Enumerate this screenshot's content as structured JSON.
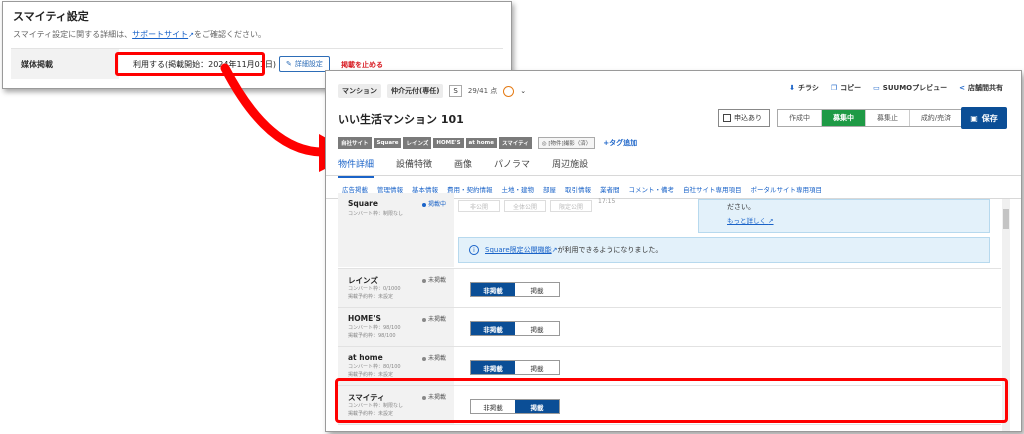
{
  "panel1": {
    "title": "スマイティ設定",
    "desc_prefix": "スマイティ設定に関する詳細は、",
    "desc_link": "サポートサイト",
    "desc_suffix": "をご確認ください。",
    "row_label": "媒体掲載",
    "status": "利用する(掲載開始：2024年11月01日)",
    "detail_button": "詳細設定",
    "stop_link": "掲載を止める"
  },
  "main": {
    "property_type": "マンション",
    "broker_type": "仲介元付(専任)",
    "grade": "S",
    "score": "29/41 点",
    "actions": [
      "チラシ",
      "コピー",
      "SUUMOプレビュー",
      "店舗間共有"
    ],
    "title": "いい生活マンション 101",
    "apply_label": "申込あり",
    "stages": [
      {
        "label": "作成中",
        "active": false
      },
      {
        "label": "募集中",
        "active": true
      },
      {
        "label": "募集止",
        "active": false
      },
      {
        "label": "成約/売済",
        "active": false
      }
    ],
    "save_label": "保存",
    "tags": [
      "自社サイト",
      "Square",
      "レインズ",
      "HOME'S",
      "at home",
      "スマイティ"
    ],
    "tag_extra": "◎ [物件]撮影（済）",
    "tag_add": "+タグ追加",
    "tabs": [
      "物件詳細",
      "設備特徴",
      "画像",
      "パノラマ",
      "周辺施設"
    ],
    "subnav": [
      "広告掲載",
      "管理情報",
      "基本情報",
      "費用・契約情報",
      "土地・建物",
      "部屋",
      "取引情報",
      "業者間",
      "コメント・備考",
      "自社サイト専用項目",
      "ポータルサイト専用項目"
    ],
    "square": {
      "name": "Square",
      "sub1": "コンバート枠：制限なし",
      "status": "掲載中",
      "ghost_buttons": [
        "非公開",
        "全体公開",
        "限定公開"
      ],
      "ghost_time": "17:15",
      "bubble_text": "ださい。",
      "bubble_more": "もっと詳しく",
      "info_link": "Square限定公開機能",
      "info_text": "が利用できるようになりました。"
    },
    "media_rows": [
      {
        "name": "レインズ",
        "sub1": "コンバート枠：0/1000",
        "sub2": "掲載予約枠：未設定",
        "status": "未掲載",
        "off": "非掲載",
        "on": "掲載",
        "selected": "off"
      },
      {
        "name": "HOME'S",
        "sub1": "コンバート枠：98/100",
        "sub2": "掲載予約枠：98/100",
        "status": "未掲載",
        "off": "非掲載",
        "on": "掲載",
        "selected": "off"
      },
      {
        "name": "at home",
        "sub1": "コンバート枠：80/100",
        "sub2": "掲載予約枠：未設定",
        "status": "未掲載",
        "off": "非掲載",
        "on": "掲載",
        "selected": "off"
      },
      {
        "name": "スマイティ",
        "sub1": "コンバート枠：制限なし",
        "sub2": "掲載予約枠：未設定",
        "status": "未掲載",
        "off": "非掲載",
        "on": "掲載",
        "selected": "on"
      }
    ]
  },
  "colors": {
    "accent": "#0b4e96",
    "active_stage": "#1e9a45",
    "highlight": "#ff0000",
    "link": "#1a63c8"
  }
}
